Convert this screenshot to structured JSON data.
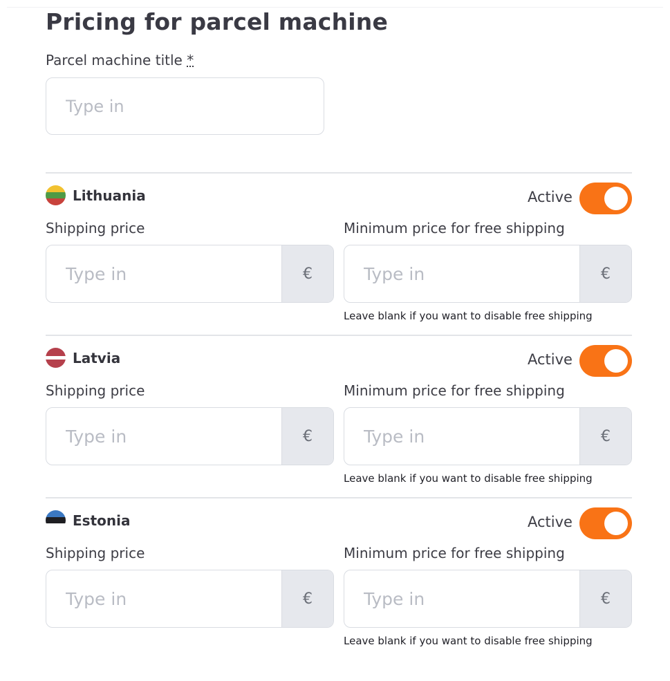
{
  "page": {
    "title": "Pricing for parcel machine",
    "machine_title_label": "Parcel machine title",
    "required_marker": "*",
    "machine_title_placeholder": "Type in"
  },
  "countries": [
    {
      "name": "Lithuania",
      "flag_colors": [
        "#f2c230",
        "#4f9a45",
        "#c8423c"
      ],
      "active_label": "Active",
      "active": true,
      "shipping_label": "Shipping price",
      "shipping_placeholder": "Type in",
      "currency": "€",
      "free_label": "Minimum price for free shipping",
      "free_placeholder": "Type in",
      "hint": "Leave blank if you want to disable free shipping"
    },
    {
      "name": "Latvia",
      "flag_colors": [
        "#b5404c",
        "#ffffff",
        "#b5404c"
      ],
      "active_label": "Active",
      "active": true,
      "shipping_label": "Shipping price",
      "shipping_placeholder": "Type in",
      "currency": "€",
      "free_label": "Minimum price for free shipping",
      "free_placeholder": "Type in",
      "hint": "Leave blank if you want to disable free shipping"
    },
    {
      "name": "Estonia",
      "flag_colors": [
        "#3b78c2",
        "#1e1e22",
        "#ffffff"
      ],
      "active_label": "Active",
      "active": true,
      "shipping_label": "Shipping price",
      "shipping_placeholder": "Type in",
      "currency": "€",
      "free_label": "Minimum price for free shipping",
      "free_placeholder": "Type in",
      "hint": "Leave blank if you want to disable free shipping"
    }
  ],
  "colors": {
    "accent": "#f97316",
    "unit_bg": "#e6e8ed",
    "border": "#d9dce2"
  }
}
